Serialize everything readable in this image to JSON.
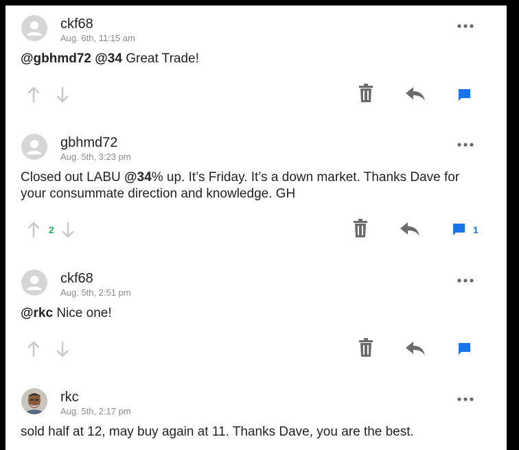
{
  "comments": [
    {
      "user": "ckf68",
      "timestamp": "Aug. 6th, 11:15 am",
      "mentions": [
        "@gbhmd72",
        "@34"
      ],
      "text": " Great Trade!",
      "avatar": "default-avatar",
      "votes": "",
      "replies": ""
    },
    {
      "user": "gbhmd72",
      "timestamp": "Aug. 5th, 3:23 pm",
      "text_line1_a": "Closed out LABU ",
      "text_line1_mention": "@34",
      "text_line1_b": "% up.  It’s Friday. It’s a down market.  Thanks Dave for",
      "text_line2": "your consummate direction and knowledge.  GH",
      "avatar": "default-avatar",
      "votes": "2",
      "replies": "1"
    },
    {
      "user": "ckf68",
      "timestamp": "Aug. 5th, 2:51 pm",
      "mentions": [
        "@rkc"
      ],
      "text": " Nice one!",
      "avatar": "default-avatar",
      "votes": "",
      "replies": ""
    },
    {
      "user": "rkc",
      "timestamp": "Aug. 5th, 2:17 pm",
      "text": "sold half at 12, may buy again at 11. Thanks Dave, you are the best.",
      "avatar": "photo-avatar"
    }
  ],
  "colors": {
    "vote_count": "#27ae60",
    "reply_count": "#1a73e8",
    "reply_bubble": "#1a73e8",
    "action_icon": "#6b6b6b",
    "arrow_icon": "#c8c8c8"
  }
}
